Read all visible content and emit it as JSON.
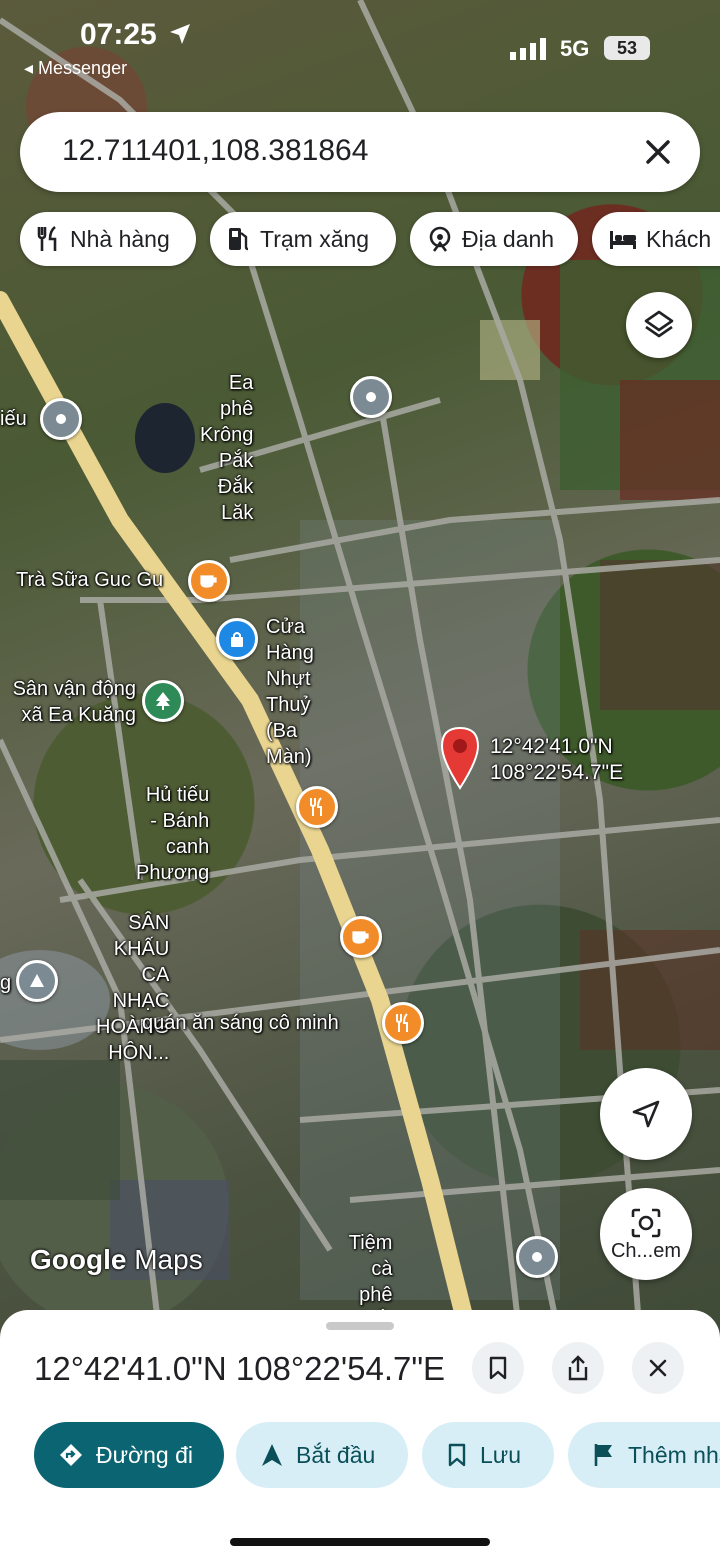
{
  "status_bar": {
    "time": "07:25",
    "back_app": "◂ Messenger",
    "network": "5G",
    "battery": "53"
  },
  "search": {
    "query": "12.711401,108.381864"
  },
  "chips": [
    {
      "label": "Nhà hàng",
      "icon": "fork-knife-icon"
    },
    {
      "label": "Trạm xăng",
      "icon": "gas-pump-icon"
    },
    {
      "label": "Địa danh",
      "icon": "landmark-icon"
    },
    {
      "label": "Khách",
      "icon": "bed-icon"
    }
  ],
  "places": {
    "ea_phe": "Ea phê Krông\nPắk Đắk Lăk",
    "tieu": "iếu",
    "tra_sua": "Trà Sữa Guc Gu",
    "cua_hang": "Cửa Hàng Nhựt\nThuỷ (Ba Màn)",
    "san_van_dong": "Sân vận động\nxã Ea Kuăng",
    "hu_tieu": "Hủ tiếu - Bánh\ncanh Phương",
    "san_khau": "SÂN KHẤU CA\nNHẠC HOÀNG HÔN...",
    "quan_an": "quán ăn sáng cô minh",
    "tiem_ca_phe": "Tiệm cà phê cắt\ntóc GIA TRẦN",
    "dropped_pin": "12°42'41.0\"N\n108°22'54.7\"E",
    "left_edge": "g"
  },
  "map_controls": {
    "lens_label": "Ch...em"
  },
  "logo": {
    "google": "Google",
    "maps": "Maps"
  },
  "sheet": {
    "title": "12°42'41.0\"N 108°22'54.7\"E",
    "actions": [
      {
        "label": "Đường đi",
        "icon": "directions-icon"
      },
      {
        "label": "Bắt đầu",
        "icon": "navigation-arrow-icon"
      },
      {
        "label": "Lưu",
        "icon": "bookmark-icon"
      },
      {
        "label": "Thêm nhãn",
        "icon": "flag-icon"
      }
    ]
  },
  "colors": {
    "primary": "#0b6471",
    "secondary_bg": "#d7eef6",
    "pin_red": "#e53935",
    "poi_orange": "#f28c28",
    "poi_blue": "#1e88e5",
    "poi_green": "#2e8b57",
    "poi_gray": "#7b8a93"
  }
}
